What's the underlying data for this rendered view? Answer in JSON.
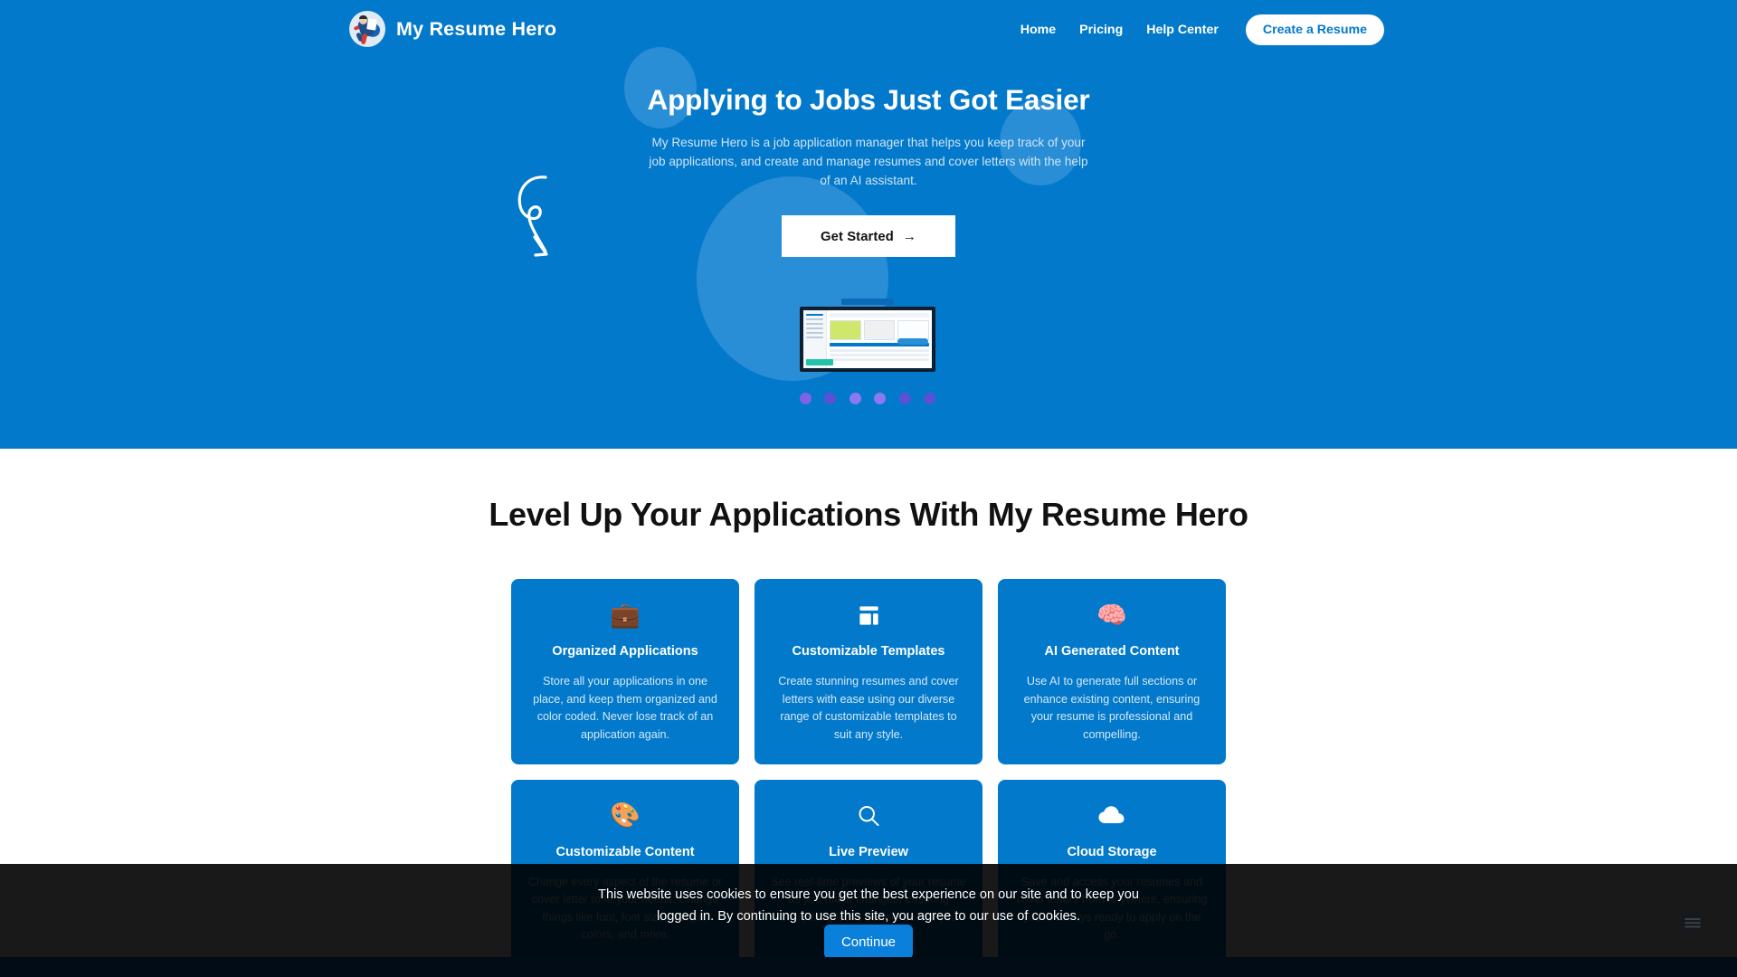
{
  "brand": {
    "name": "My Resume Hero",
    "logo_icon": "superhero-avatar-icon"
  },
  "nav": {
    "links": [
      {
        "label": "Home"
      },
      {
        "label": "Pricing"
      },
      {
        "label": "Help Center"
      }
    ],
    "cta_label": "Create a Resume"
  },
  "hero": {
    "title": "Applying to Jobs Just Got Easier",
    "subtitle": "My Resume Hero is a job application manager that helps you keep track of your job applications, and create and manage resumes and cover letters with the help of an AI assistant.",
    "cta_label": "Get Started",
    "cta_arrow": "→",
    "decoration_icon": "curly-arrow-icon",
    "mockup_icon": "app-screenshot-mockup",
    "carousel_dots": 6,
    "background_color": "#0279cb",
    "decoration_circle_color": "#2a8ed6"
  },
  "features": {
    "section_title": "Level Up Your Applications With My Resume Hero",
    "card_color": "#0279cb",
    "cards": [
      {
        "icon": "💼",
        "icon_name": "briefcase-icon",
        "title": "Organized Applications",
        "text": "Store all your applications in one place, and keep them organized and color coded. Never lose track of an application again."
      },
      {
        "icon": "",
        "icon_name": "template-layout-icon",
        "title": "Customizable Templates",
        "text": "Create stunning resumes and cover letters with ease using our diverse range of customizable templates to suit any style."
      },
      {
        "icon": "🧠",
        "icon_name": "brain-icon",
        "title": "AI Generated Content",
        "text": "Use AI to generate full sections or enhance existing content, ensuring your resume is professional and compelling."
      },
      {
        "icon": "🎨",
        "icon_name": "palette-icon",
        "title": "Customizable Content",
        "text": "Change every aspect of the resume or cover letter to fit your needs. Change things like font, font size, margin, colors, and more."
      },
      {
        "icon": "",
        "icon_name": "magnifying-glass-icon",
        "title": "Live Preview",
        "text": "See real-time previews of your resume as you make changes, ensuring everything looks perfect before you apply."
      },
      {
        "icon": "",
        "icon_name": "cloud-icon",
        "title": "Cloud Storage",
        "text": "Save and access your resumes and cover letters from anywhere, ensuring you're always ready to apply on the go."
      }
    ]
  },
  "cookie_banner": {
    "text": "This website uses cookies to ensure you get the best experience on our site and to keep you logged in. By continuing to use this site, you agree to our use of cookies.",
    "button_label": "Continue",
    "button_color": "#0b80da"
  },
  "chat_widget": {
    "icon_name": "chat-bubble-icon"
  }
}
